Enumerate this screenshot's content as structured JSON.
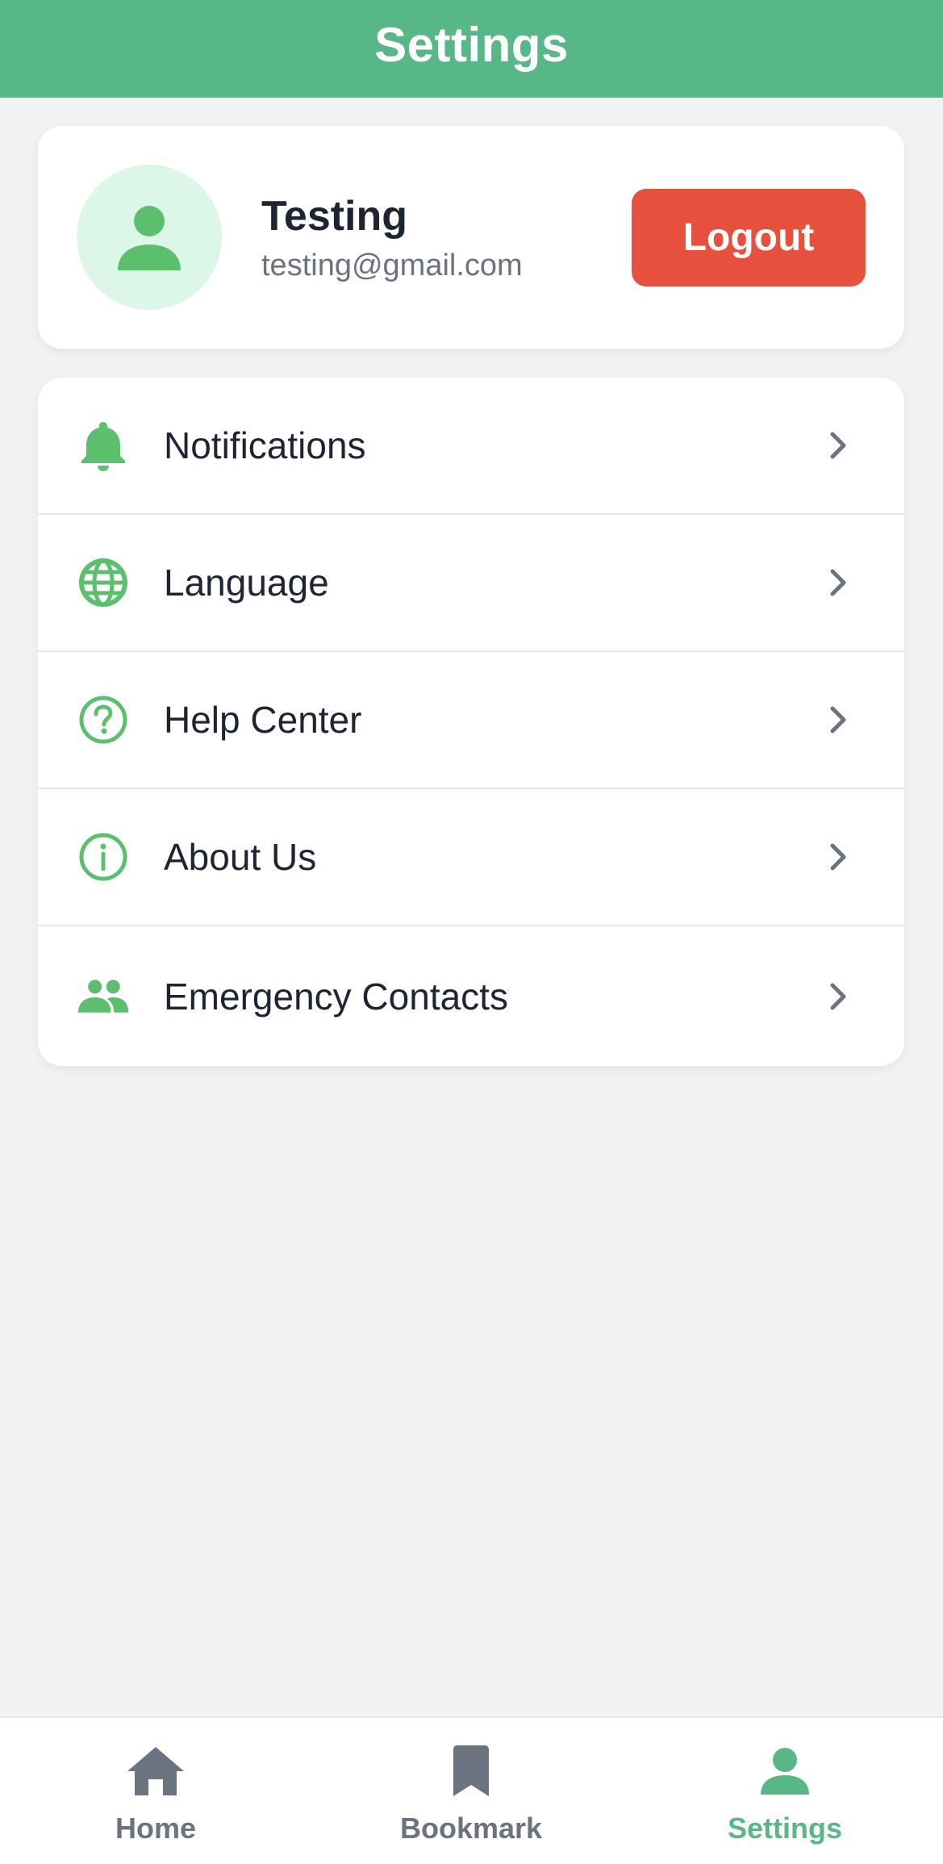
{
  "header": {
    "title": "Settings"
  },
  "profile": {
    "avatar_icon": "person-icon",
    "name": "Testing",
    "email": "testing@gmail.com",
    "logout_label": "Logout"
  },
  "menu": {
    "items": [
      {
        "label": "Notifications",
        "icon": "bell-icon"
      },
      {
        "label": "Language",
        "icon": "globe-icon"
      },
      {
        "label": "Help Center",
        "icon": "help-circle-icon"
      },
      {
        "label": "About Us",
        "icon": "info-circle-icon"
      },
      {
        "label": "Emergency Contacts",
        "icon": "people-icon"
      }
    ]
  },
  "bottom_nav": {
    "items": [
      {
        "label": "Home",
        "icon": "home-icon",
        "active": false
      },
      {
        "label": "Bookmark",
        "icon": "bookmark-icon",
        "active": false
      },
      {
        "label": "Settings",
        "icon": "person-icon",
        "active": true
      }
    ]
  },
  "colors": {
    "accent": "#57b786",
    "icon_green": "#5cbf6e",
    "logout_red": "#e8503e",
    "avatar_bg": "#dcf6e7",
    "text_dark": "#1d2433",
    "text_muted": "#6b7280",
    "background": "#f0f2f4"
  }
}
